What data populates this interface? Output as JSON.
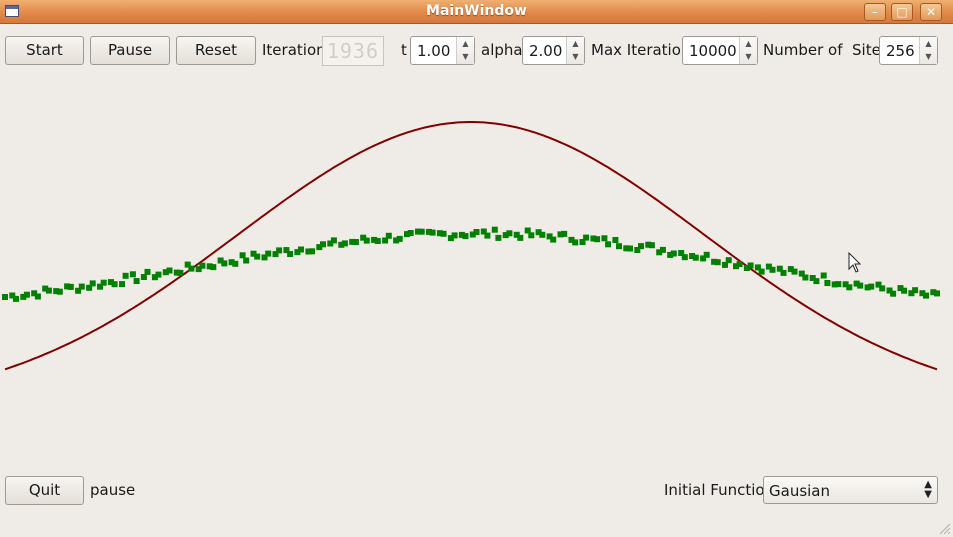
{
  "window": {
    "title": "MainWindow",
    "minimize": "–",
    "maximize": "□",
    "close": "✕"
  },
  "toolbar": {
    "start_label": "Start",
    "pause_label": "Pause",
    "reset_label": "Reset",
    "iteration_label": "Iteration",
    "iteration_value": "1936",
    "t_label": "t",
    "t_value": "1.00",
    "alpha_label": "alpha",
    "alpha_value": "2.00",
    "max_iteration_label": "Max Iteration",
    "max_iteration_value": "10000",
    "sites_label": "Number of  Sites",
    "sites_value": "256"
  },
  "footer": {
    "quit_label": "Quit",
    "status_text": "pause",
    "initial_function_label": "Initial Function",
    "initial_function_value": "Gausian"
  },
  "colors": {
    "initial_curve": "#800000",
    "current_points": "#008000",
    "background": "#efebe7"
  },
  "chart_data": {
    "type": "scatter",
    "n_sites": 256,
    "series": [
      {
        "style": "line",
        "color": "#800000",
        "peak": 1.0,
        "edge_value": 0.0,
        "width": 0.25
      },
      {
        "style": "points",
        "color": "#008000",
        "center_value": 0.61,
        "left_edge_value": 0.32,
        "right_edge_value": 0.31
      }
    ],
    "ylim": [
      0,
      1
    ],
    "grid": false
  }
}
